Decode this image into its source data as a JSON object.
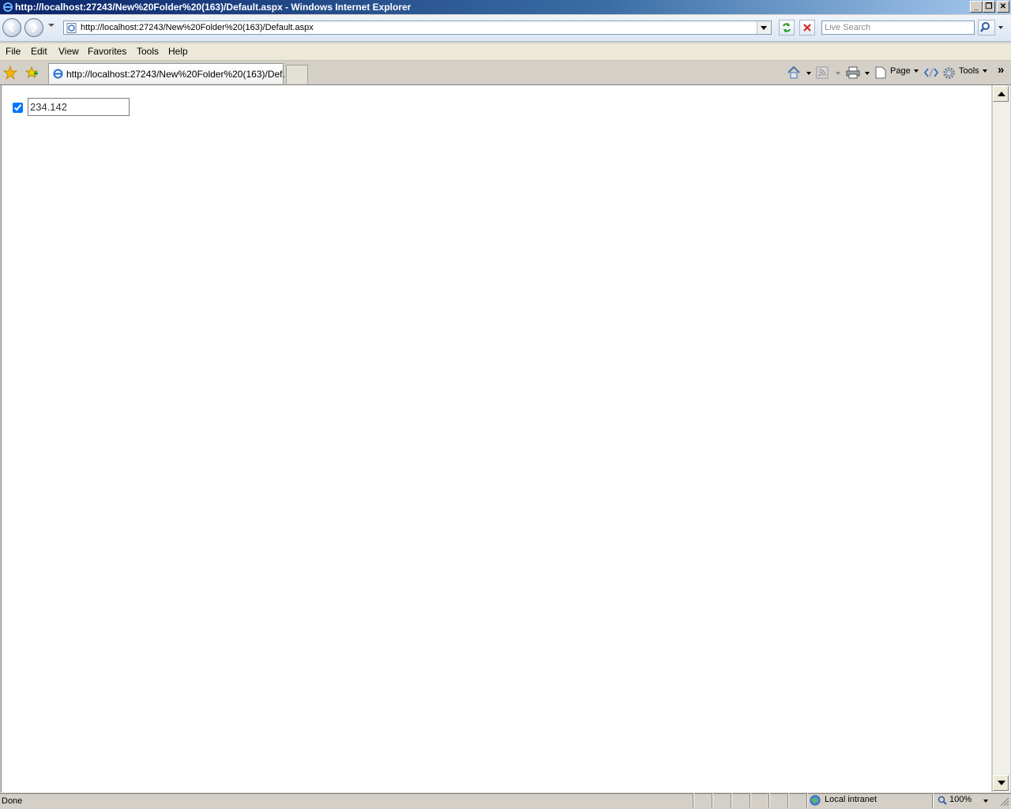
{
  "window": {
    "title": "http://localhost:27243/New%20Folder%20(163)/Default.aspx - Windows Internet Explorer",
    "minimize": "_",
    "restore": "❐",
    "close": "✕"
  },
  "navigation": {
    "address": "http://localhost:27243/New%20Folder%20(163)/Default.aspx",
    "search_placeholder": "Live Search"
  },
  "menu": {
    "file": "File",
    "edit": "Edit",
    "view": "View",
    "favorites": "Favorites",
    "tools": "Tools",
    "help": "Help"
  },
  "tabs": [
    {
      "label": "http://localhost:27243/New%20Folder%20(163)/Def..."
    }
  ],
  "commandbar": {
    "page": "Page",
    "tools": "Tools",
    "more": "»"
  },
  "page": {
    "checkbox_checked": true,
    "textbox_value": "234.142"
  },
  "status": {
    "text": "Done",
    "zone": "Local intranet",
    "zoom": "100%"
  },
  "colors": {
    "title_bar": "#0a246a",
    "chrome": "#d4d0c8",
    "content_bg": "#ffffff"
  }
}
